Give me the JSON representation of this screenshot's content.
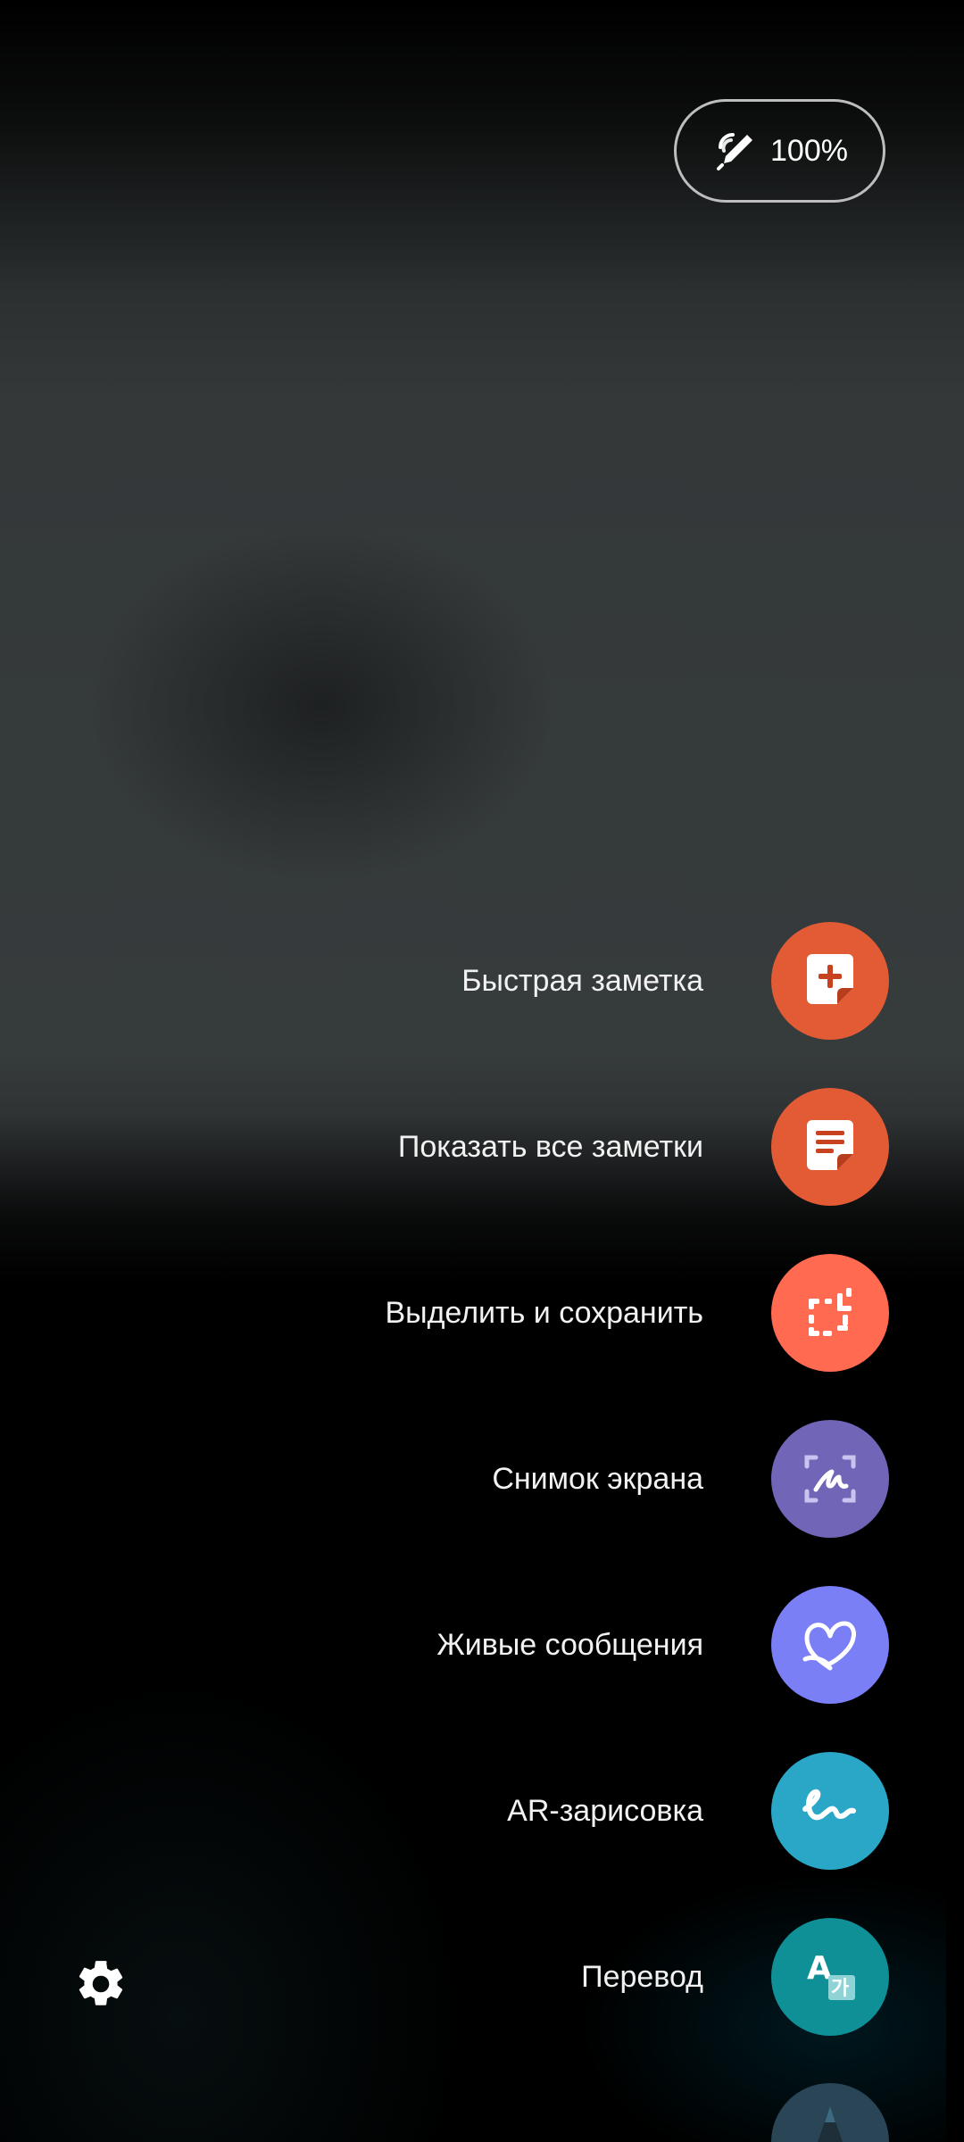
{
  "battery": {
    "percent_text": "100%",
    "icon": "spen-pen-icon"
  },
  "menu": {
    "items": [
      {
        "label": "Быстрая заметка",
        "icon": "quick-note-icon",
        "color": "#e35b35"
      },
      {
        "label": "Показать все заметки",
        "icon": "notes-list-icon",
        "color": "#e35b35"
      },
      {
        "label": "Выделить и сохранить",
        "icon": "smart-select-icon",
        "color": "#ff6a50"
      },
      {
        "label": "Снимок экрана",
        "icon": "screen-write-icon",
        "color": "#7165b8"
      },
      {
        "label": "Живые сообщения",
        "icon": "live-message-heart-icon",
        "color": "#7a7ff5"
      },
      {
        "label": "AR-зарисовка",
        "icon": "ar-doodle-icon",
        "color": "#2aa6c7"
      },
      {
        "label": "Перевод",
        "icon": "translate-icon",
        "color": "#0f9096"
      }
    ]
  },
  "settings": {
    "icon": "gear-icon"
  }
}
